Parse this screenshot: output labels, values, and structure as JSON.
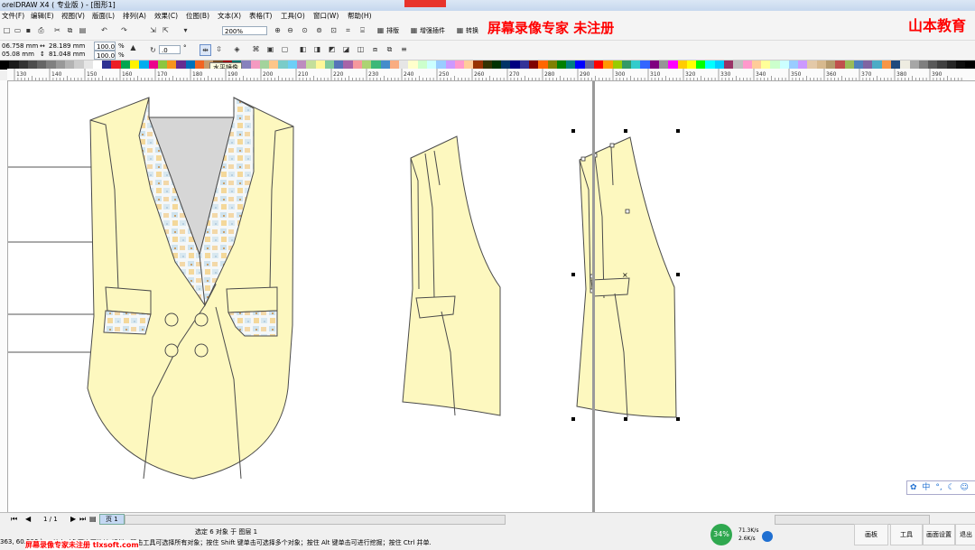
{
  "app": {
    "title": "orelDRAW X4 ( 专业版 ) - [图形1]"
  },
  "menu": [
    "文件(F)",
    "编辑(E)",
    "视图(V)",
    "版面(L)",
    "排列(A)",
    "效果(C)",
    "位图(B)",
    "文本(X)",
    "表格(T)",
    "工具(O)",
    "窗口(W)",
    "帮助(H)"
  ],
  "toolbar": {
    "zoom_value": "200%",
    "layout_label": "排版",
    "plugin_label": "增强插件",
    "convert_label": "转换"
  },
  "property_bar": {
    "x": "06.758 mm",
    "y": "05.08 mm",
    "w": "28.189 mm",
    "h": "81.048 mm",
    "scale_x": "100.0",
    "scale_y": "100.0",
    "pct": "%",
    "rotate": ".0",
    "deg": "°"
  },
  "tooltip": "水平镜像",
  "ruler_labels": [
    "130",
    "140",
    "150",
    "160",
    "170",
    "180",
    "190",
    "200",
    "210",
    "220",
    "230",
    "240",
    "250",
    "260",
    "270",
    "280",
    "290",
    "300",
    "310",
    "320",
    "330",
    "340",
    "350",
    "360",
    "370",
    "380",
    "390"
  ],
  "palette_colors": [
    "#000000",
    "#1a1a1a",
    "#333333",
    "#4d4d4d",
    "#666666",
    "#808080",
    "#999999",
    "#b3b3b3",
    "#cccccc",
    "#e6e6e6",
    "#ffffff",
    "#2e3192",
    "#ed1c24",
    "#00a651",
    "#fff200",
    "#00aeef",
    "#ec008c",
    "#8dc63f",
    "#f7941d",
    "#662d91",
    "#0072bc",
    "#f26522",
    "#c69c6d",
    "#754c24",
    "#9e0b0f",
    "#00746b",
    "#8781bd",
    "#f49ac1",
    "#a3d39c",
    "#fdc689",
    "#7accc8",
    "#6dcff6",
    "#bd8cbf",
    "#c4df9b",
    "#fff799",
    "#82ca9c",
    "#5674b9",
    "#a864a8",
    "#f6989d",
    "#acd373",
    "#3cb878",
    "#448ccb",
    "#f9ad81",
    "#e6e6e6",
    "#ffffcc",
    "#ccffcc",
    "#ccffff",
    "#99ccff",
    "#cc99ff",
    "#ff99cc",
    "#ffcc99",
    "#993300",
    "#333300",
    "#003300",
    "#003366",
    "#000080",
    "#333399",
    "#800000",
    "#ff6600",
    "#808000",
    "#008000",
    "#008080",
    "#0000ff",
    "#666699",
    "#ff0000",
    "#ff9900",
    "#99cc00",
    "#339966",
    "#33cccc",
    "#3366ff",
    "#800080",
    "#969696",
    "#ff00ff",
    "#ffcc00",
    "#ffff00",
    "#00ff00",
    "#00ffff",
    "#00ccff",
    "#993366",
    "#c0c0c0",
    "#ff99cc",
    "#ffcc99",
    "#ffff99",
    "#ccffcc",
    "#ccffff",
    "#99ccff",
    "#cc99ff",
    "#e3c9a8",
    "#d7b98e",
    "#b59a6d",
    "#c0504d",
    "#9bbb59",
    "#4f81bd",
    "#8064a2",
    "#4bacc6",
    "#f79646",
    "#1f497d",
    "#eeece1",
    "#a6a6a6",
    "#7f7f7f",
    "#595959",
    "#404040",
    "#262626",
    "#0d0d0d",
    "#000000"
  ],
  "watermark": {
    "center": "屏幕录像专家 未注册",
    "brand": "山本教育",
    "bottom_left": "屏幕录像专家未注册 tlxsoft.com"
  },
  "status": {
    "coords": "363, 60.506 )",
    "page_nav": "1 / 1",
    "page_tab": "页 1",
    "selection": "选定 6 对象 于 图层 1",
    "hint": "单击对象两次可旋转/倾斜；双击工具可选择所有对象；按住 Shift 键单击可选择多个对象；按住 Alt 键单击可进行挖掘；按住 Ctrl 并单...",
    "cpu": "34%",
    "net_up": "71.3K/s",
    "net_down": "2.6K/s"
  },
  "ime": {
    "lang": "中",
    "punct": "°,"
  },
  "taskbar": {
    "board": "画板",
    "tools": "工具",
    "page_setup": "画面设置",
    "exit": "退出"
  },
  "colors": {
    "vest_fill": "#fdf8bf",
    "vest_stroke": "#4a4a4a",
    "lining": "#d6d6d6",
    "accent": "#1f6fd1"
  }
}
